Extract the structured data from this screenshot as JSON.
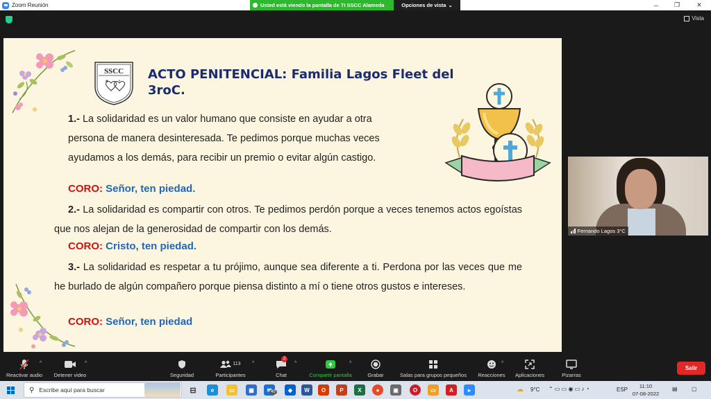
{
  "window": {
    "title": "Zoom Reunión",
    "share_banner": "Usted está viendo la pantalla de TI SSCC Alameda",
    "view_options": "Opciones de vista",
    "vista_label": "Vista"
  },
  "slide": {
    "logo_text": "SSCC",
    "title": "ACTO PENITENCIAL: Familia Lagos Fleet del 3roC.",
    "p1_num": "1.-",
    "p1_l1": "La solidaridad es un valor humano que consiste en ayudar a otra",
    "p1_l2": "persona de manera desinteresada. Te pedimos porque muchas veces",
    "p1_l3": "ayudamos a los demás, para recibir un premio o evitar algún castigo.",
    "coro1_label": "CORO:",
    "coro1_text": "Señor, ten piedad.",
    "p2_num": "2.-",
    "p2_text": "La solidaridad es compartir con otros. Te pedimos perdón porque a veces tenemos actos egoístas que nos alejan de la generosidad de compartir con los demás.",
    "coro2_label": "CORO:",
    "coro2_text": "Cristo, ten piedad.",
    "p3_num": "3.-",
    "p3_text": "La solidaridad es respetar a tu prójimo, aunque sea diferente a ti. Perdona por las veces que me he burlado de algún compañero porque piensa distinto a mí o tiene otros gustos e intereses.",
    "coro3_label": "CORO:",
    "coro3_text": "Señor, ten piedad"
  },
  "participant": {
    "name": "Fernando Lagos 3°C"
  },
  "toolbar": {
    "mute": "Reactivar audio",
    "video": "Detener video",
    "security": "Seguridad",
    "participants": "Participantes",
    "participants_count": "113",
    "chat": "Chat",
    "chat_badge": "2",
    "share": "Compartir pantalla",
    "record": "Grabar",
    "breakout": "Salas para grupos pequeños",
    "reactions": "Reacciones",
    "apps": "Aplicaciones",
    "whiteboards": "Pizarras",
    "leave": "Salir"
  },
  "taskbar": {
    "search_placeholder": "Escribe aquí para buscar",
    "mail_badge": "40",
    "weather": "9°C",
    "language": "ESP",
    "time": "11:10",
    "date": "07-08-2022"
  }
}
